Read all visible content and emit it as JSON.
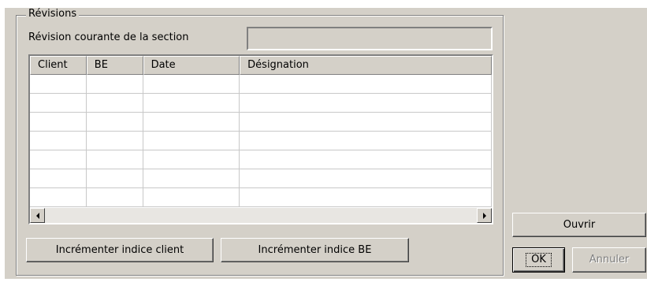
{
  "revisions": {
    "group_title": "Révisions",
    "current_revision_label": "Révision courante de la section",
    "current_revision_value": "",
    "columns": [
      "Client",
      "BE",
      "Date",
      "Désignation"
    ],
    "rows": [
      [
        "",
        "",
        "",
        ""
      ],
      [
        "",
        "",
        "",
        ""
      ],
      [
        "",
        "",
        "",
        ""
      ],
      [
        "",
        "",
        "",
        ""
      ],
      [
        "",
        "",
        "",
        ""
      ],
      [
        "",
        "",
        "",
        ""
      ],
      [
        "",
        "",
        "",
        ""
      ]
    ]
  },
  "buttons": {
    "increment_client": "Incrémenter indice client",
    "increment_be": "Incrémenter indice BE",
    "open": "Ouvrir",
    "ok": "OK",
    "cancel": "Annuler"
  },
  "icons": {
    "scroll_left": "arrow-left-icon",
    "scroll_right": "arrow-right-icon"
  },
  "colors": {
    "dialog_bg": "#d4d0c8",
    "disabled_text": "#808080"
  }
}
